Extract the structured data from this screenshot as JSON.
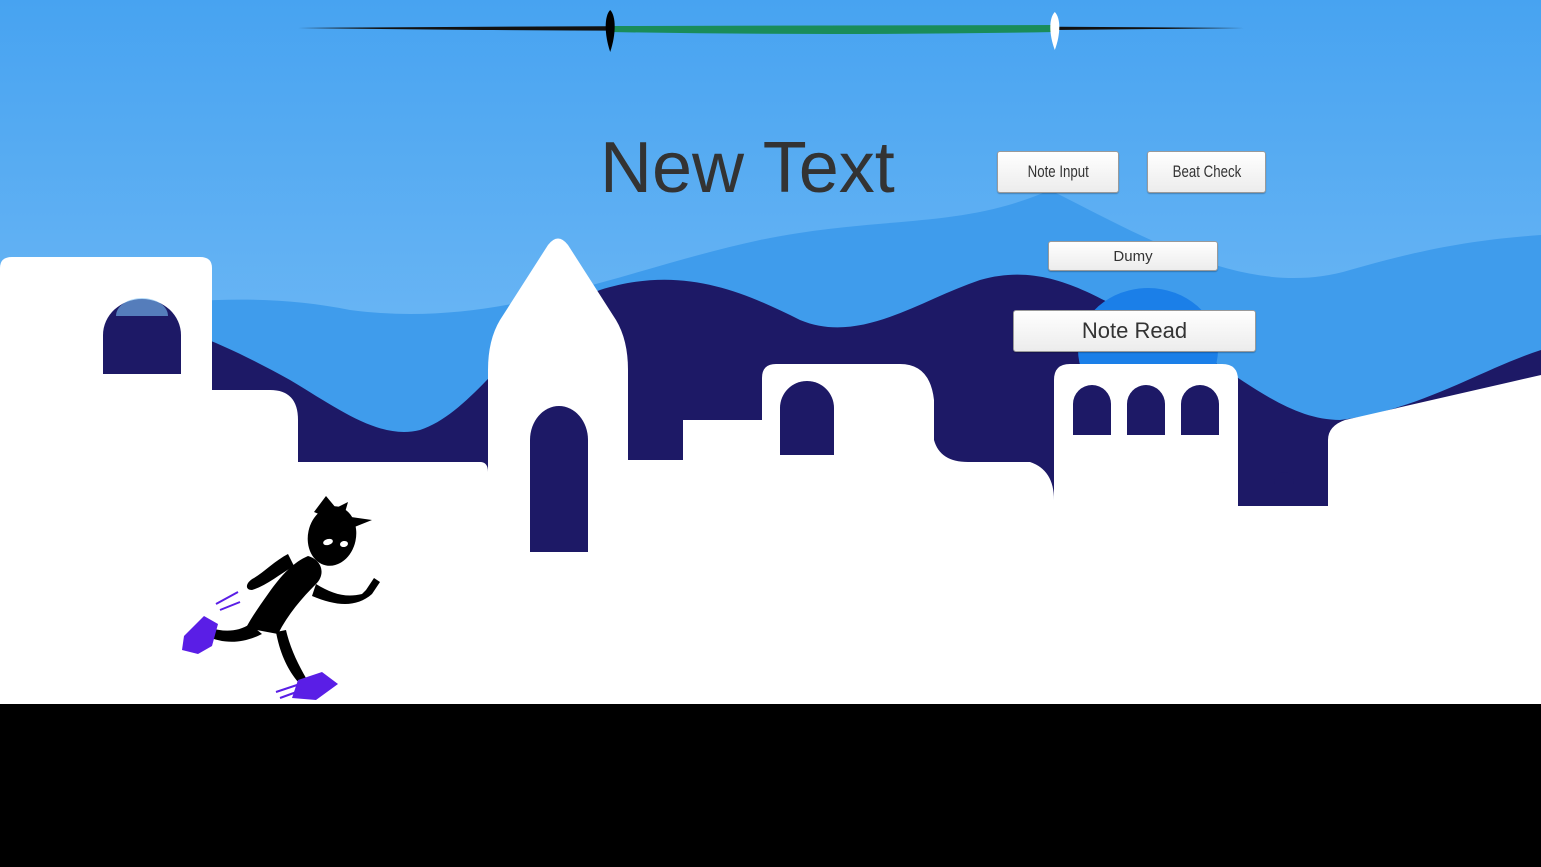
{
  "hud": {
    "title_text": "New Text",
    "progress_range": {
      "start_fraction": 0.33,
      "end_fraction": 0.8
    },
    "colors": {
      "sky_top": "#4aa6f2",
      "sky_bottom": "#8cc8f8",
      "mountain_dark": "#1e1a66",
      "mountain_mid": "#3d99ec",
      "progress_fill": "#1a8c5a",
      "handle_left": "#000000",
      "handle_right": "#ffffff",
      "shoe_accent": "#5a1ee6"
    }
  },
  "buttons": {
    "note_input": "Note Input",
    "beat_check": "Beat Check",
    "dumy": "Dumy",
    "note_read": "Note Read"
  },
  "icons": {
    "left_handle": "slider-handle-dark",
    "right_handle": "slider-handle-light",
    "character": "running-silhouette"
  }
}
